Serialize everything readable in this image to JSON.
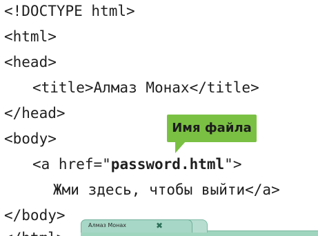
{
  "code": {
    "line1": "<!DOCTYPE html>",
    "line2": "<html>",
    "line3": "<head>",
    "line4": "<title>Алмаз Монах</title>",
    "line5": "</head>",
    "line6": "<body>",
    "line7_prefix": "<a href=\"",
    "line7_filename": "password.html",
    "line7_suffix": "\">",
    "line8": "Жми здесь, чтобы выйти</a>",
    "line9": "</body>",
    "line10": "</html>"
  },
  "callout": {
    "label": "Имя файла",
    "color": "#7ac143"
  },
  "browser": {
    "tab_title": "Алмаз Монах",
    "close_icon": "close-icon",
    "tab_color": "#a7d7c6"
  }
}
